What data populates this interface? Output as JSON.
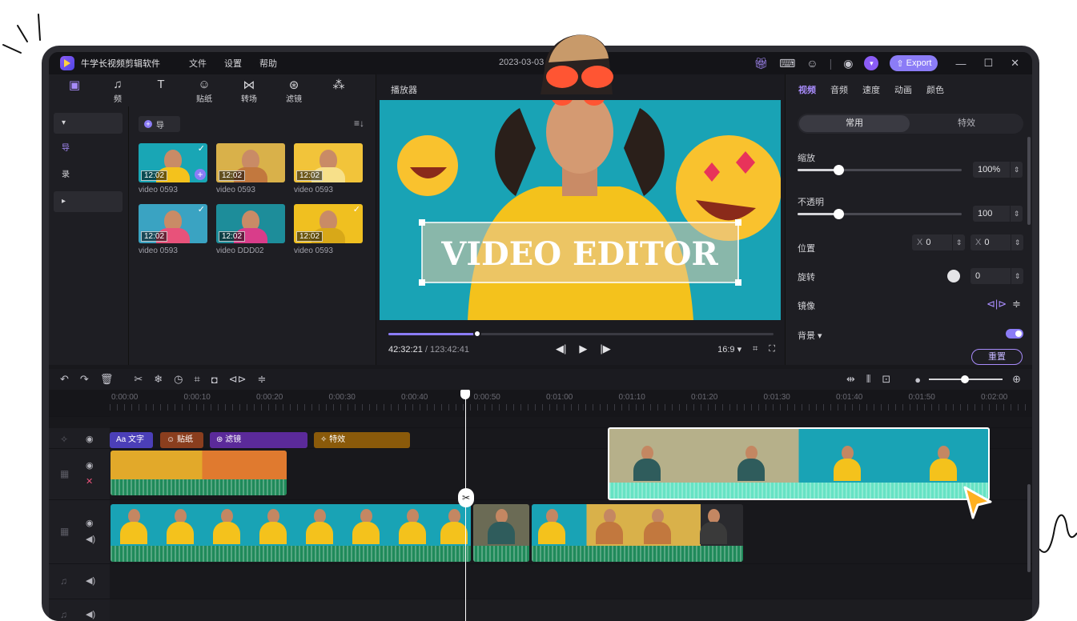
{
  "app": {
    "title": "牛学长视频剪辑软件",
    "menu": [
      "文件",
      "设置",
      "帮助"
    ],
    "date": "2023-03-03",
    "export_label": "Export"
  },
  "toolbar": {
    "items": [
      {
        "icon": "media-icon",
        "label": ""
      },
      {
        "icon": "music-note-icon",
        "label": "频"
      },
      {
        "icon": "text-icon",
        "label": ""
      },
      {
        "icon": "sticker-icon",
        "label": "贴纸"
      },
      {
        "icon": "transition-icon",
        "label": "转场"
      },
      {
        "icon": "filter-icon",
        "label": "滤镜"
      },
      {
        "icon": "magic-wand-icon",
        "label": ""
      }
    ]
  },
  "left_panel": {
    "items": [
      "导",
      "录"
    ]
  },
  "media": {
    "import_label": "导",
    "items": [
      {
        "duration": "12:02",
        "name": "video 0593",
        "bg": "#19a6b5",
        "shirt": "#f4c21c",
        "checked": true
      },
      {
        "duration": "12:02",
        "name": "video 0593",
        "bg": "#d9b14a",
        "shirt": "#c2783e",
        "checked": false
      },
      {
        "duration": "12:02",
        "name": "video 0593",
        "bg": "#f2c43a",
        "shirt": "#f7e08a",
        "checked": false
      },
      {
        "duration": "12:02",
        "name": "video 0593",
        "bg": "#3aa3c2",
        "shirt": "#e8527a",
        "checked": true
      },
      {
        "duration": "12:02",
        "name": "video DDD02",
        "bg": "#1d8d9a",
        "shirt": "#d93d8a",
        "checked": false
      },
      {
        "duration": "12:02",
        "name": "video 0593",
        "bg": "#f0c020",
        "shirt": "#d8a818",
        "checked": true
      }
    ]
  },
  "player": {
    "title": "播放器",
    "overlay_text": "VIDEO EDITOR",
    "current_time": "42:32:21",
    "duration": "123:42:41",
    "separator": " / ",
    "aspect": "16:9",
    "progress": 0.23
  },
  "properties": {
    "tabs": [
      "视频",
      "音频",
      "速度",
      "动画",
      "颜色"
    ],
    "active_tab": 0,
    "segment": [
      "常用",
      "特效"
    ],
    "scale_label": "缩放",
    "scale_value": "100%",
    "scale_level": 0.25,
    "opacity_label": "不透明",
    "opacity_value": "100",
    "opacity_level": 0.25,
    "position_label": "位置",
    "pos_x_prefix": "X",
    "pos_x": "0",
    "pos_y_prefix": "X",
    "pos_y": "0",
    "rotation_label": "旋转",
    "rotation_value": "0",
    "mirror_label": "镜像",
    "background_label": "背景",
    "reset_label": "重置"
  },
  "timeline": {
    "ticks": [
      "0:00:00",
      "0:00:10",
      "0:00:20",
      "0:00:30",
      "0:00:40",
      "0:00:50",
      "0:01:00",
      "0:01:10",
      "0:01:20",
      "0:01:30",
      "0:01:40",
      "0:01:50",
      "0:02:00"
    ],
    "chips": [
      {
        "label": "文字",
        "prefix": "Aa",
        "color": "#4b3fb8"
      },
      {
        "label": "贴纸",
        "prefix": "☺",
        "color": "#8a3e1e"
      },
      {
        "label": "滤镜",
        "prefix": "⊛",
        "color": "#5b2a9a"
      },
      {
        "label": "特效",
        "prefix": "✧",
        "color": "#8a5a0a"
      }
    ]
  },
  "colors": {
    "accent": "#8b7cf6",
    "audio_green": "#1f8a5a",
    "clip_teal": "#66e3c4"
  }
}
